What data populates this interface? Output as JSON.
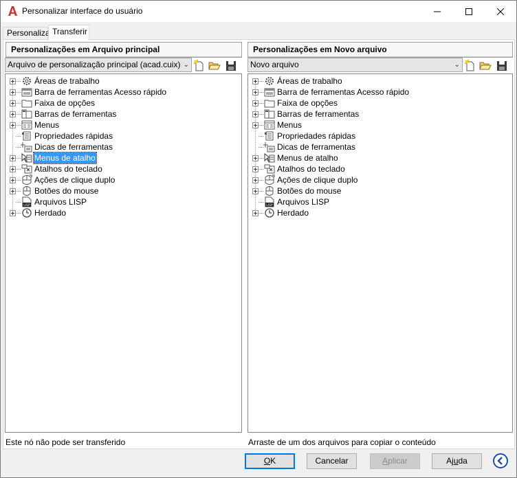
{
  "window": {
    "title": "Personalizar interface do usuário",
    "controls": {
      "minimize": "—",
      "maximize": "☐",
      "close": "✕"
    }
  },
  "tabs": [
    {
      "label": "Personalizar",
      "active": false
    },
    {
      "label": "Transferir",
      "active": true
    }
  ],
  "left_panel": {
    "header": "Personalizações em Arquivo principal",
    "combo_value": "Arquivo de personalização principal (acad.cuix)",
    "status": "Este nó não pode ser transferido",
    "selected_index": 7
  },
  "right_panel": {
    "header": "Personalizações em Novo arquivo",
    "combo_value": "Novo arquivo",
    "status": "Arraste de um dos arquivos para copiar o conteúdo"
  },
  "tree_items": [
    {
      "label": "Áreas de trabalho",
      "icon": "workspace-gear-icon",
      "expandable": true
    },
    {
      "label": "Barra de ferramentas Acesso rápido",
      "icon": "quick-access-toolbar-icon",
      "expandable": true
    },
    {
      "label": "Faixa de opções",
      "icon": "ribbon-icon",
      "expandable": true
    },
    {
      "label": "Barras de ferramentas",
      "icon": "toolbars-icon",
      "expandable": true
    },
    {
      "label": "Menus",
      "icon": "menus-icon",
      "expandable": true
    },
    {
      "label": "Propriedades rápidas",
      "icon": "quick-properties-icon",
      "expandable": false
    },
    {
      "label": "Dicas de ferramentas",
      "icon": "tooltips-icon",
      "expandable": false
    },
    {
      "label": "Menus de atalho",
      "icon": "shortcut-menus-icon",
      "expandable": true
    },
    {
      "label": "Atalhos do teclado",
      "icon": "keyboard-shortcuts-icon",
      "expandable": true
    },
    {
      "label": "Ações de clique duplo",
      "icon": "double-click-icon",
      "expandable": true
    },
    {
      "label": "Botões do mouse",
      "icon": "mouse-buttons-icon",
      "expandable": true
    },
    {
      "label": "Arquivos LISP",
      "icon": "lisp-files-icon",
      "expandable": false
    },
    {
      "label": "Herdado",
      "icon": "legacy-clock-icon",
      "expandable": true
    }
  ],
  "buttons": {
    "ok": {
      "label": "OK",
      "mnemonic": "O",
      "rest": "K"
    },
    "cancel": {
      "label": "Cancelar"
    },
    "apply": {
      "label": "Aplicar",
      "mnemonic": "A",
      "rest": "plicar"
    },
    "help": {
      "label": "Ajuda",
      "pre": "Aj",
      "mnemonic": "u",
      "rest": "da"
    }
  },
  "colors": {
    "selection": "#3399ff",
    "app_icon_red": "#d0312d",
    "default_button_border": "#0078d7",
    "collapse_button_blue": "#1f4e9b"
  }
}
